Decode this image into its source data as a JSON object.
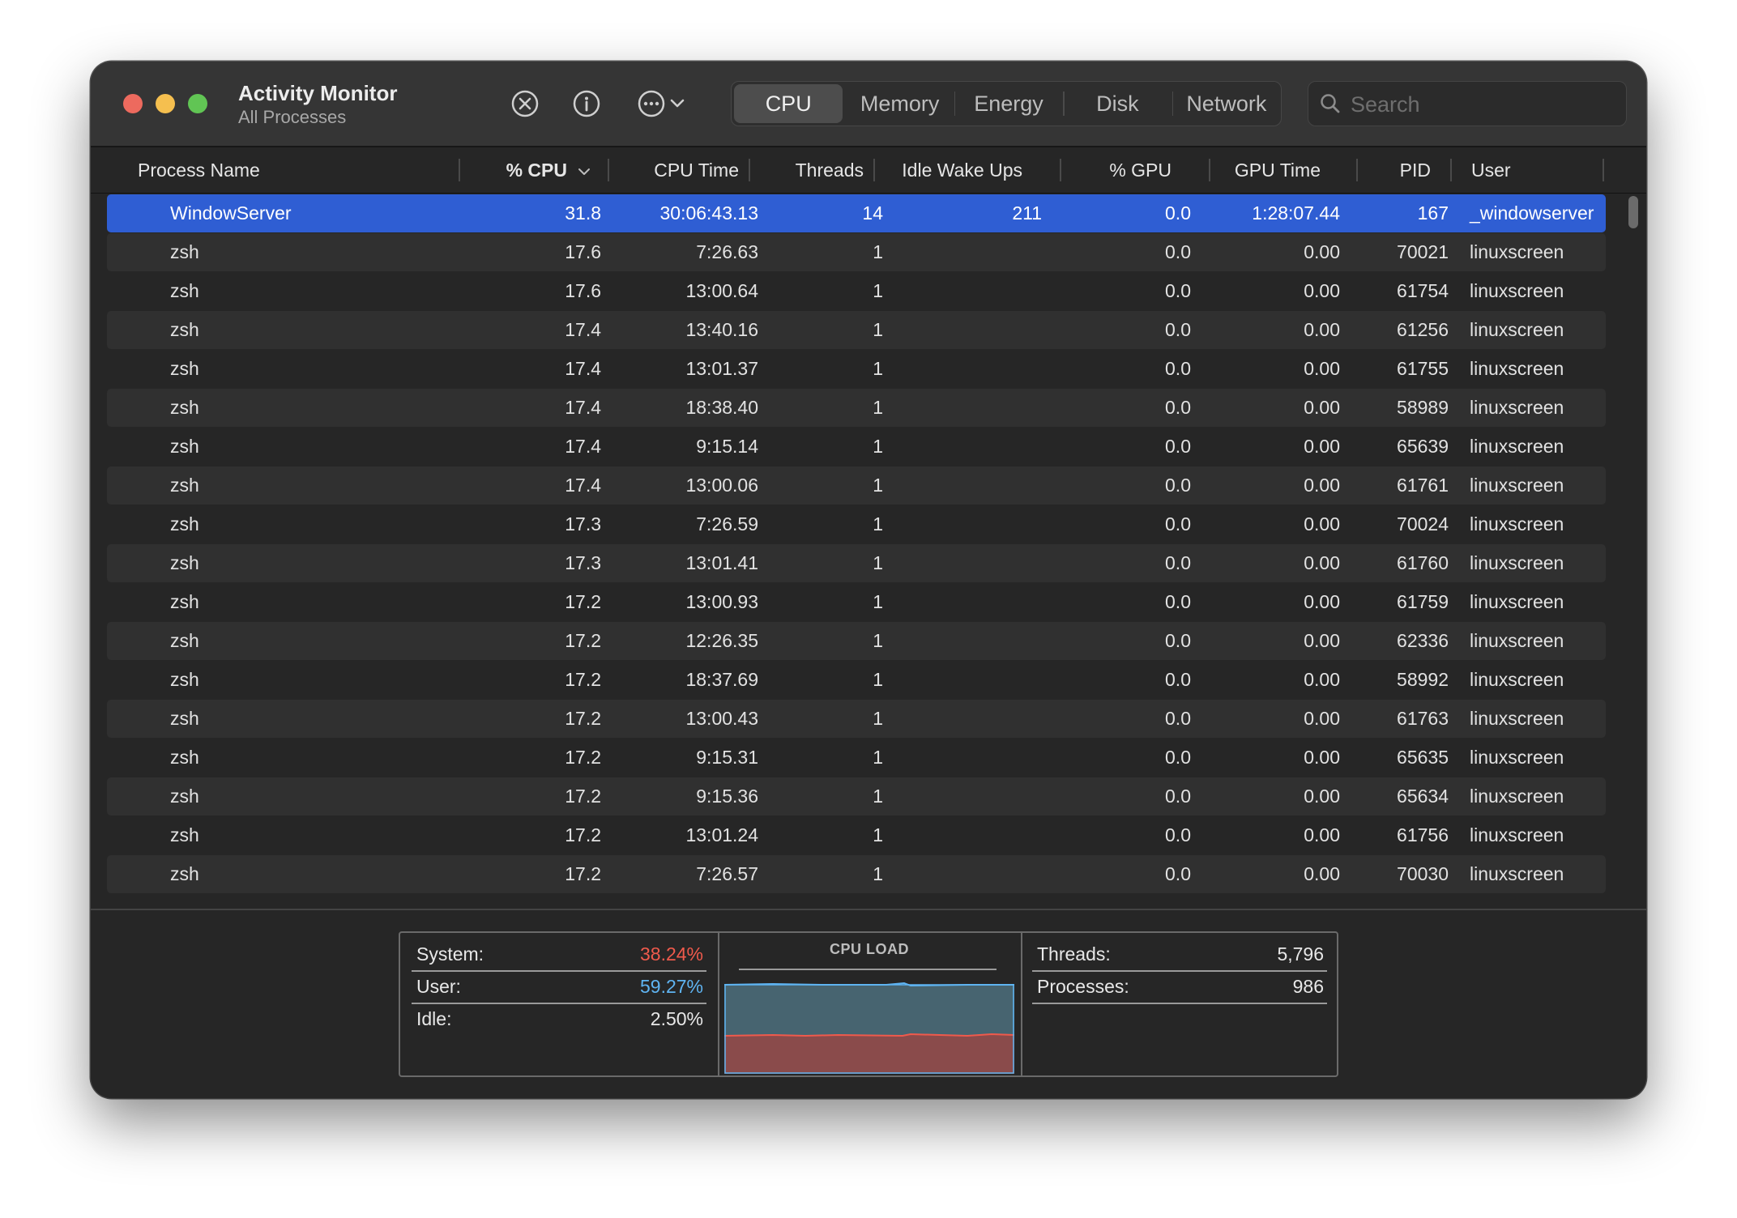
{
  "window": {
    "title": "Activity Monitor",
    "subtitle": "All Processes"
  },
  "toolbar": {
    "icons": [
      "stop-process-icon",
      "info-icon",
      "more-actions-icon",
      "chevron-down-icon"
    ],
    "tabs": [
      "CPU",
      "Memory",
      "Energy",
      "Disk",
      "Network"
    ],
    "active_tab": "CPU",
    "search_placeholder": "Search"
  },
  "table": {
    "columns": [
      "Process Name",
      "% CPU",
      "CPU Time",
      "Threads",
      "Idle Wake Ups",
      "% GPU",
      "GPU Time",
      "PID",
      "User"
    ],
    "sort_column": "% CPU",
    "rows": [
      [
        "WindowServer",
        "31.8",
        "30:06:43.13",
        "14",
        "211",
        "0.0",
        "1:28:07.44",
        "167",
        "_windowserver"
      ],
      [
        "zsh",
        "17.6",
        "7:26.63",
        "1",
        "",
        "0.0",
        "0.00",
        "70021",
        "linuxscreen"
      ],
      [
        "zsh",
        "17.6",
        "13:00.64",
        "1",
        "",
        "0.0",
        "0.00",
        "61754",
        "linuxscreen"
      ],
      [
        "zsh",
        "17.4",
        "13:40.16",
        "1",
        "",
        "0.0",
        "0.00",
        "61256",
        "linuxscreen"
      ],
      [
        "zsh",
        "17.4",
        "13:01.37",
        "1",
        "",
        "0.0",
        "0.00",
        "61755",
        "linuxscreen"
      ],
      [
        "zsh",
        "17.4",
        "18:38.40",
        "1",
        "",
        "0.0",
        "0.00",
        "58989",
        "linuxscreen"
      ],
      [
        "zsh",
        "17.4",
        "9:15.14",
        "1",
        "",
        "0.0",
        "0.00",
        "65639",
        "linuxscreen"
      ],
      [
        "zsh",
        "17.4",
        "13:00.06",
        "1",
        "",
        "0.0",
        "0.00",
        "61761",
        "linuxscreen"
      ],
      [
        "zsh",
        "17.3",
        "7:26.59",
        "1",
        "",
        "0.0",
        "0.00",
        "70024",
        "linuxscreen"
      ],
      [
        "zsh",
        "17.3",
        "13:01.41",
        "1",
        "",
        "0.0",
        "0.00",
        "61760",
        "linuxscreen"
      ],
      [
        "zsh",
        "17.2",
        "13:00.93",
        "1",
        "",
        "0.0",
        "0.00",
        "61759",
        "linuxscreen"
      ],
      [
        "zsh",
        "17.2",
        "12:26.35",
        "1",
        "",
        "0.0",
        "0.00",
        "62336",
        "linuxscreen"
      ],
      [
        "zsh",
        "17.2",
        "18:37.69",
        "1",
        "",
        "0.0",
        "0.00",
        "58992",
        "linuxscreen"
      ],
      [
        "zsh",
        "17.2",
        "13:00.43",
        "1",
        "",
        "0.0",
        "0.00",
        "61763",
        "linuxscreen"
      ],
      [
        "zsh",
        "17.2",
        "9:15.31",
        "1",
        "",
        "0.0",
        "0.00",
        "65635",
        "linuxscreen"
      ],
      [
        "zsh",
        "17.2",
        "9:15.36",
        "1",
        "",
        "0.0",
        "0.00",
        "65634",
        "linuxscreen"
      ],
      [
        "zsh",
        "17.2",
        "13:01.24",
        "1",
        "",
        "0.0",
        "0.00",
        "61756",
        "linuxscreen"
      ],
      [
        "zsh",
        "17.2",
        "7:26.57",
        "1",
        "",
        "0.0",
        "0.00",
        "70030",
        "linuxscreen"
      ]
    ],
    "selected_row": 0
  },
  "summary": {
    "system_label": "System:",
    "system_value": "38.24%",
    "user_label": "User:",
    "user_value": "59.27%",
    "idle_label": "Idle:",
    "idle_value": "2.50%",
    "cpu_load_title": "CPU LOAD",
    "threads_label": "Threads:",
    "threads_value": "5,796",
    "processes_label": "Processes:",
    "processes_value": "986"
  },
  "colors": {
    "selection": "#2f5ed3",
    "system": "#ef5a4c",
    "user": "#5fb4f2",
    "user_fill": "#476470",
    "system_fill": "#8a4b4b"
  }
}
